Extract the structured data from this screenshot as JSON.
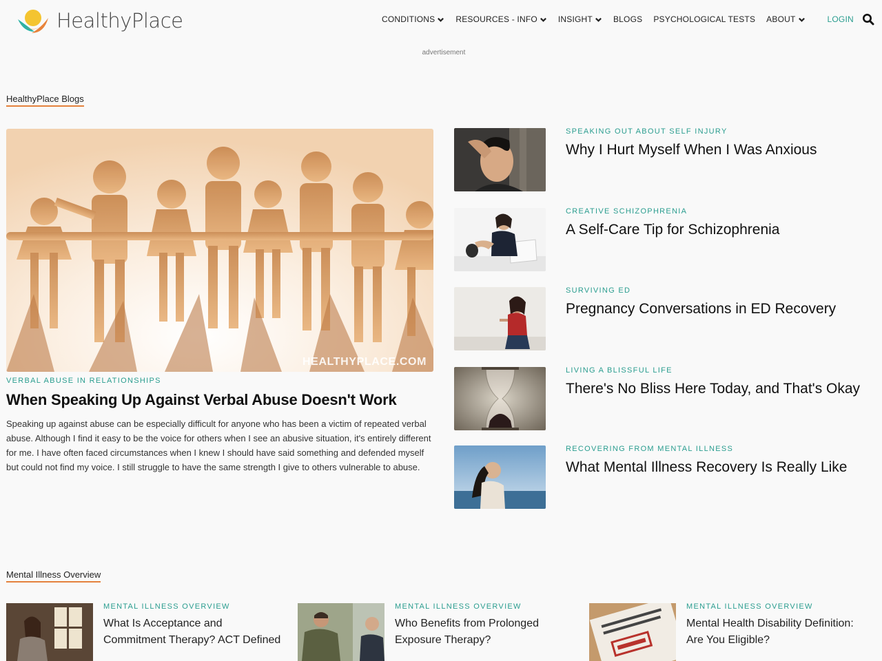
{
  "header": {
    "logo_text": "HealthyPlace",
    "nav": [
      {
        "label": "CONDITIONS",
        "has_dropdown": true
      },
      {
        "label": "RESOURCES - INFO",
        "has_dropdown": true
      },
      {
        "label": "INSIGHT",
        "has_dropdown": true
      },
      {
        "label": "BLOGS",
        "has_dropdown": false
      },
      {
        "label": "PSYCHOLOGICAL TESTS",
        "has_dropdown": false
      },
      {
        "label": "ABOUT",
        "has_dropdown": true
      }
    ],
    "login_label": "LOGIN",
    "search_icon": "search-icon"
  },
  "advertisement_label": "advertisement",
  "blogs": {
    "section_title": "HealthyPlace Blogs",
    "feature": {
      "watermark": "HEALTHYPLACE.COM",
      "kicker": "VERBAL ABUSE IN RELATIONSHIPS",
      "title": "When Speaking Up Against Verbal Abuse Doesn't Work",
      "excerpt": "Speaking up against abuse can be especially difficult for anyone who has been a victim of repeated verbal abuse. Although I find it easy to be the voice for others when I see an abusive situation, it's entirely different for me. I have often faced circumstances when I knew I should have said something and defended myself but could not find my voice. I still struggle to have the same strength I give to others vulnerable to abuse."
    },
    "side": [
      {
        "kicker": "SPEAKING OUT ABOUT SELF INJURY",
        "title": "Why I Hurt Myself When I Was Anxious"
      },
      {
        "kicker": "CREATIVE SCHIZOPHRENIA",
        "title": "A Self-Care Tip for Schizophrenia"
      },
      {
        "kicker": "SURVIVING ED",
        "title": "Pregnancy Conversations in ED Recovery"
      },
      {
        "kicker": "LIVING A BLISSFUL LIFE",
        "title": "There's No Bliss Here Today, and That's Okay"
      },
      {
        "kicker": "RECOVERING FROM MENTAL ILLNESS",
        "title": "What Mental Illness Recovery Is Really Like"
      }
    ]
  },
  "overview": {
    "section_title": "Mental Illness Overview",
    "items": [
      {
        "kicker": "MENTAL ILLNESS OVERVIEW",
        "title": "What Is Acceptance and Commitment Therapy? ACT Defined"
      },
      {
        "kicker": "MENTAL ILLNESS OVERVIEW",
        "title": "Who Benefits from Prolonged Exposure Therapy?"
      },
      {
        "kicker": "MENTAL ILLNESS OVERVIEW",
        "title": "Mental Health Disability Definition: Are You Eligible?"
      }
    ]
  },
  "colors": {
    "accent_teal": "#2a9d8f",
    "underline_orange": "#e4813c",
    "background": "#f9f9f9"
  }
}
